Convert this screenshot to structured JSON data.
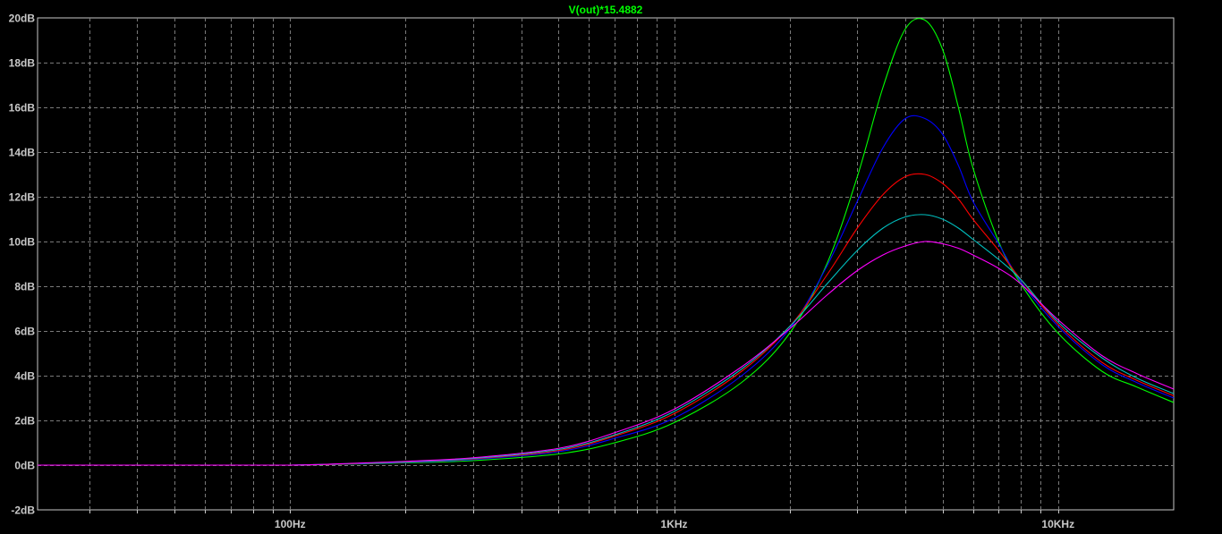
{
  "chart_data": {
    "type": "line",
    "title": "V(out)*15.4882",
    "title_color": "#00ff00",
    "xlabel": "",
    "ylabel": "",
    "x_scale": "log",
    "xlim": [
      22,
      20000
    ],
    "ylim": [
      -2,
      20
    ],
    "grid": true,
    "x_ticks": [
      {
        "value": 100,
        "label": "100Hz"
      },
      {
        "value": 1000,
        "label": "1KHz"
      },
      {
        "value": 10000,
        "label": "10KHz"
      }
    ],
    "y_ticks": [
      {
        "value": 20,
        "label": "20dB"
      },
      {
        "value": 18,
        "label": "18dB"
      },
      {
        "value": 16,
        "label": "16dB"
      },
      {
        "value": 14,
        "label": "14dB"
      },
      {
        "value": 12,
        "label": "12dB"
      },
      {
        "value": 10,
        "label": "10dB"
      },
      {
        "value": 8,
        "label": "8dB"
      },
      {
        "value": 6,
        "label": "6dB"
      },
      {
        "value": 4,
        "label": "4dB"
      },
      {
        "value": 2,
        "label": "2dB"
      },
      {
        "value": 0,
        "label": "0dB"
      },
      {
        "value": -2,
        "label": "-2dB"
      }
    ],
    "x": [
      22,
      50,
      100,
      150,
      200,
      300,
      500,
      700,
      1000,
      1500,
      2000,
      2500,
      3000,
      3500,
      4000,
      4500,
      5000,
      5500,
      6000,
      7000,
      8000,
      10000,
      13000,
      16000,
      20000
    ],
    "series": [
      {
        "color": "#00ff00",
        "values": [
          0,
          0,
          0,
          0.05,
          0.1,
          0.2,
          0.5,
          1.0,
          1.9,
          3.7,
          5.9,
          9.0,
          12.9,
          16.9,
          19.5,
          19.9,
          18.6,
          16.0,
          13.3,
          10.0,
          8.1,
          5.9,
          4.2,
          3.5,
          2.8
        ]
      },
      {
        "color": "#0000ff",
        "values": [
          0,
          0,
          0,
          0.06,
          0.12,
          0.25,
          0.6,
          1.2,
          2.1,
          4.0,
          6.1,
          8.9,
          11.8,
          14.2,
          15.5,
          15.5,
          14.8,
          13.4,
          11.8,
          9.9,
          8.2,
          6.2,
          4.5,
          3.7,
          3.0
        ]
      },
      {
        "color": "#ff0000",
        "values": [
          0,
          0,
          0,
          0.07,
          0.14,
          0.28,
          0.65,
          1.3,
          2.3,
          4.2,
          6.2,
          8.5,
          10.6,
          12.1,
          12.9,
          13.0,
          12.6,
          11.9,
          11.0,
          9.6,
          8.3,
          6.3,
          4.6,
          3.8,
          3.1
        ]
      },
      {
        "color": "#00c0c0",
        "values": [
          0,
          0,
          0,
          0.08,
          0.15,
          0.3,
          0.7,
          1.35,
          2.4,
          4.3,
          6.2,
          8.1,
          9.6,
          10.6,
          11.1,
          11.2,
          11.0,
          10.6,
          10.1,
          9.2,
          8.3,
          6.4,
          4.8,
          3.9,
          3.2
        ]
      },
      {
        "color": "#ff00ff",
        "values": [
          0,
          0,
          0,
          0.09,
          0.17,
          0.33,
          0.75,
          1.45,
          2.5,
          4.4,
          6.1,
          7.6,
          8.7,
          9.4,
          9.8,
          10.0,
          9.9,
          9.7,
          9.4,
          8.8,
          8.1,
          6.5,
          4.9,
          4.1,
          3.4
        ]
      }
    ]
  }
}
